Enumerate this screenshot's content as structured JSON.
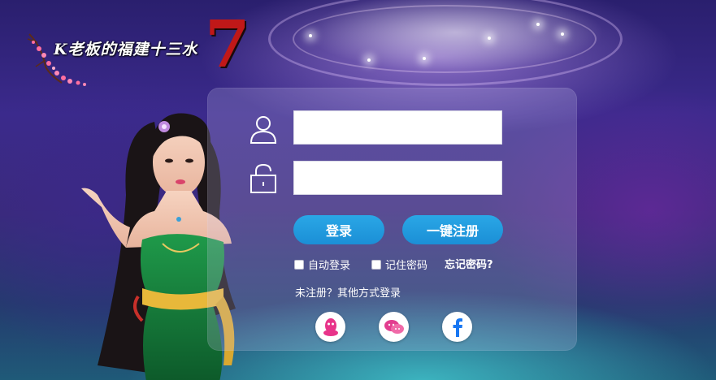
{
  "app": {
    "title": "K老板的福建十三水",
    "logo_mark": "7"
  },
  "login_form": {
    "username": {
      "value": "",
      "placeholder": ""
    },
    "password": {
      "value": "",
      "placeholder": ""
    },
    "login_label": "登录",
    "register_label": "一键注册",
    "auto_login_label": "自动登录",
    "remember_password_label": "记住密码",
    "forgot_password_label": "忘记密码?",
    "other_login_label": "未注册？其他方式登录"
  },
  "social_logins": [
    {
      "name": "qq",
      "icon": "qq-icon"
    },
    {
      "name": "wechat",
      "icon": "wechat-icon"
    },
    {
      "name": "facebook",
      "icon": "facebook-icon"
    }
  ],
  "colors": {
    "button_blue": "#1b8fd6",
    "facebook_blue": "#1877f2",
    "qq_pink": "#e8348a",
    "wechat_pink": "#e23d8f",
    "logo_red": "#c01818"
  }
}
